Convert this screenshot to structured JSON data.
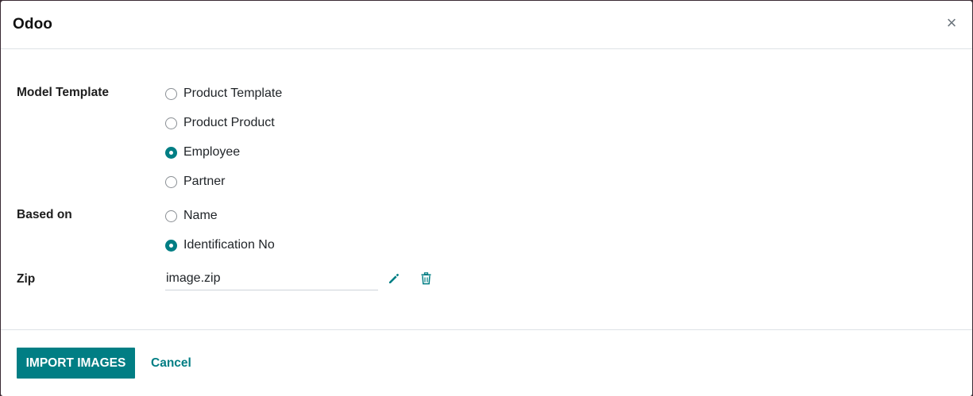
{
  "dialog": {
    "title": "Odoo",
    "close_label": "×"
  },
  "form": {
    "model_template": {
      "label": "Model Template",
      "options": [
        {
          "label": "Product Template",
          "checked": false
        },
        {
          "label": "Product Product",
          "checked": false
        },
        {
          "label": "Employee",
          "checked": true
        },
        {
          "label": "Partner",
          "checked": false
        }
      ]
    },
    "based_on": {
      "label": "Based on",
      "options": [
        {
          "label": "Name",
          "checked": false
        },
        {
          "label": "Identification No",
          "checked": true
        }
      ]
    },
    "zip": {
      "label": "Zip",
      "value": "image.zip",
      "edit_icon": "pencil-icon",
      "delete_icon": "trash-icon"
    }
  },
  "footer": {
    "import_label": "IMPORT IMAGES",
    "cancel_label": "Cancel"
  },
  "colors": {
    "accent": "#017e84",
    "backdrop": "#3a2a33"
  }
}
